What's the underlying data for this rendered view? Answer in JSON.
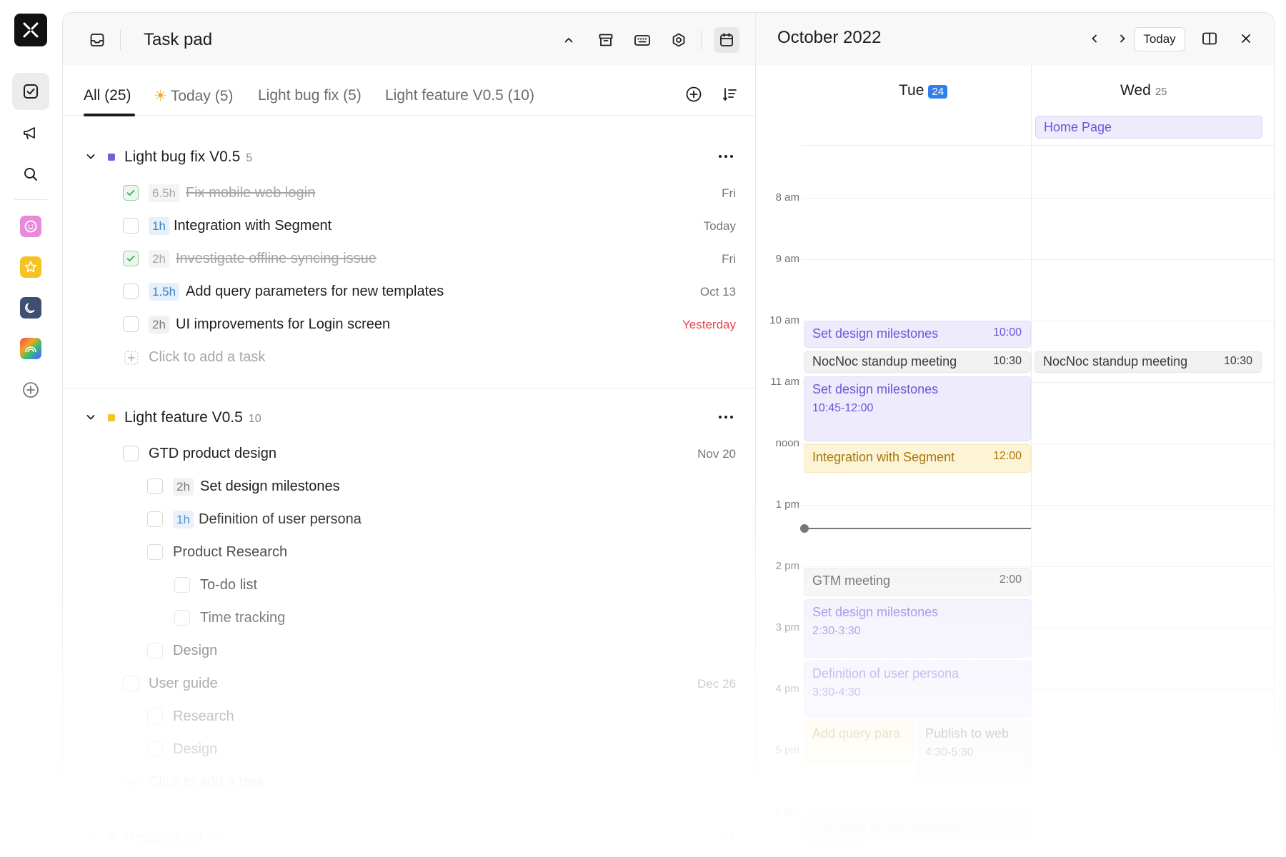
{
  "rail": {
    "logo": "app-logo",
    "items": [
      "task-icon",
      "megaphone-icon",
      "search-icon"
    ],
    "apps": [
      {
        "name": "smiley-app-icon",
        "color": "#e58bd9"
      },
      {
        "name": "star-app-icon",
        "color": "#f6c324"
      },
      {
        "name": "moon-app-icon",
        "color": "#3e4f6f"
      },
      {
        "name": "rainbow-app-icon",
        "color": "#f06b3a"
      }
    ],
    "add": "plus-circle-icon"
  },
  "taskpad": {
    "title": "Task pad",
    "tabs": [
      "All (25)",
      "Today (5)",
      "Light bug fix (5)",
      "Light feature V0.5 (10)"
    ],
    "today_emoji": "☀",
    "groups": [
      {
        "title": "Light bug fix V0.5",
        "count": "5",
        "color": "#7b5cd6",
        "tasks": [
          {
            "dur": "6.5h",
            "text": "Fix mobile web login",
            "due": "Fri",
            "done": true
          },
          {
            "dur": "1h",
            "text": "Integration with Segment",
            "due": "Today",
            "done": false
          },
          {
            "dur": "2h",
            "text": "Investigate offline syncing issue",
            "due": "Fri",
            "done": true
          },
          {
            "dur": "1.5h",
            "text": "Add query parameters for new templates",
            "due": "Oct 13",
            "done": false
          },
          {
            "dur": "2h",
            "text": "UI improvements for Login screen",
            "due": "Yesterday",
            "done": false
          }
        ],
        "add": "Click to add a task"
      },
      {
        "title": "Light feature V0.5",
        "count": "10",
        "color": "#f6c324",
        "tasks": [
          {
            "text": "GTD product design",
            "due": "Nov 20"
          },
          {
            "dur": "2h",
            "text": "Set design milestones"
          },
          {
            "dur": "1h",
            "text": "Definition of user persona"
          },
          {
            "text": "Product Research"
          },
          {
            "text": "To-do list"
          },
          {
            "text": "Time tracking"
          },
          {
            "text": "Design"
          },
          {
            "text": "User guide",
            "due": "Dec 26"
          },
          {
            "text": "Research"
          },
          {
            "text": "Design"
          }
        ],
        "add": "Click to add a task"
      },
      {
        "title": "Reading list",
        "count": "10",
        "color": "#7b5cd6"
      }
    ]
  },
  "calendar": {
    "title": "October 2022",
    "today_label": "Today",
    "days": [
      {
        "name": "Tue",
        "num": "24"
      },
      {
        "name": "Wed",
        "num": "25"
      }
    ],
    "allday": "Home Page",
    "hours": [
      "8 am",
      "9 am",
      "10 am",
      "11 am",
      "noon",
      "1 pm",
      "2 pm",
      "3 pm",
      "4 pm",
      "5 pm",
      "6 pm"
    ],
    "events": [
      {
        "title": "Set design milestones",
        "time": "10:00"
      },
      {
        "title": "NocNoc standup meeting",
        "time": "10:30"
      },
      {
        "title": "NocNoc standup meeting",
        "time": "10:30"
      },
      {
        "title": "Set design milestones",
        "time": "10:45-12:00"
      },
      {
        "title": "Integration with Segment",
        "time": "12:00"
      },
      {
        "title": "GTM meeting",
        "time": "2:00"
      },
      {
        "title": "Set design milestones",
        "time": "2:30-3:30"
      },
      {
        "title": "Definition of user persona",
        "time": "3:30-4:30"
      },
      {
        "title": "Add query para"
      },
      {
        "title": "Publish to web",
        "time": "4:30-5:30"
      },
      {
        "title": "Definition of user persona",
        "time": "6:00-7:00"
      }
    ]
  }
}
